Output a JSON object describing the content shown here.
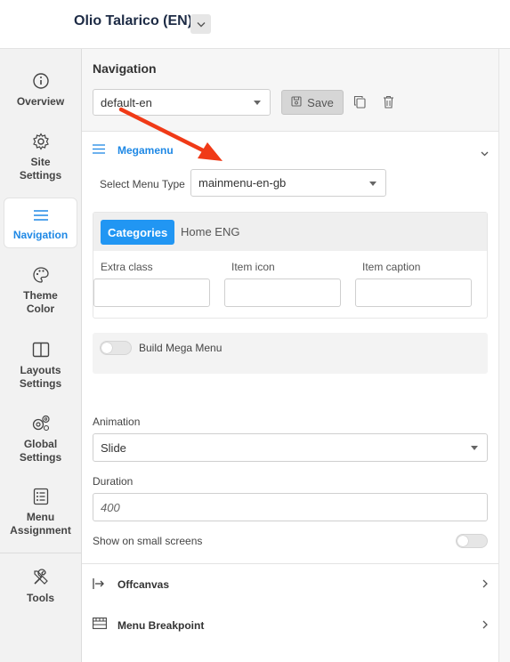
{
  "header": {
    "site_title": "Olio Talarico (EN)"
  },
  "sidebar": {
    "items": [
      {
        "label": "Overview"
      },
      {
        "label": "Site Settings"
      },
      {
        "label": "Navigation"
      },
      {
        "label": "Theme Color"
      },
      {
        "label": "Layouts Settings"
      },
      {
        "label": "Global Settings"
      },
      {
        "label": "Menu Assignment"
      },
      {
        "label": "Tools"
      }
    ]
  },
  "navigation": {
    "title": "Navigation",
    "preset_value": "default-en",
    "save_label": "Save"
  },
  "megamenu": {
    "title": "Megamenu",
    "select_label": "Select Menu Type",
    "menu_type_value": "mainmenu-en-gb",
    "tabs": [
      {
        "label": "Categories"
      },
      {
        "label": "Home ENG"
      }
    ],
    "fields": [
      {
        "label": "Extra class"
      },
      {
        "label": "Item icon"
      },
      {
        "label": "Item caption"
      }
    ],
    "build_mega_label": "Build Mega Menu",
    "animation_label": "Animation",
    "animation_value": "Slide",
    "duration_label": "Duration",
    "duration_placeholder": "400",
    "small_screens_label": "Show on small screens"
  },
  "accordions": [
    {
      "label": "Offcanvas"
    },
    {
      "label": "Menu Breakpoint"
    }
  ],
  "colors": {
    "accent": "#2196f3",
    "annotation_arrow": "#f03a17"
  }
}
